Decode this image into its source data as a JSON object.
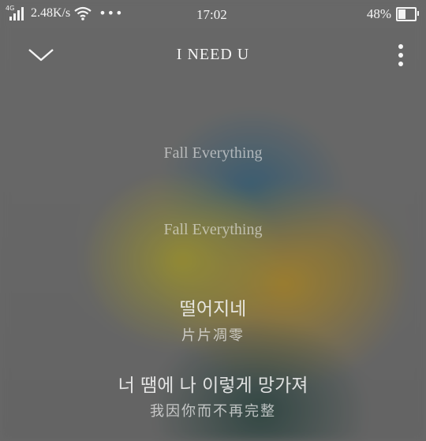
{
  "status_bar": {
    "network_type": "4G",
    "net_speed": "2.48K/s",
    "more": "•••",
    "time": "17:02",
    "battery_percent": "48%",
    "battery_level": 0.48
  },
  "header": {
    "title": "I NEED U",
    "collapse_icon": "chevron-down-icon",
    "menu_icon": "more-vertical-icon"
  },
  "lyrics": [
    {
      "text": "Fall Everything",
      "style": "en"
    },
    {
      "text": "Fall Everything",
      "style": "en"
    },
    {
      "text": "떨어지네",
      "style": "ko"
    },
    {
      "text": "片片凋零",
      "style": "zh"
    },
    {
      "text": "너 땜에 나 이렇게 망가져",
      "style": "ko"
    },
    {
      "text": "我因你而不再完整",
      "style": "zh"
    }
  ]
}
